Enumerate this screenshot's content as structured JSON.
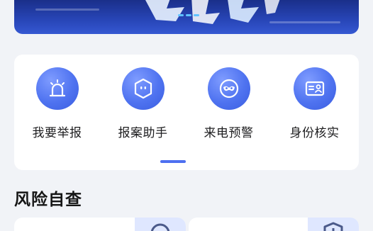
{
  "banner": {
    "image_icon": "banner-image"
  },
  "services": [
    {
      "label": "我要举报",
      "icon": "alarm-light-icon"
    },
    {
      "label": "报案助手",
      "icon": "robot-assistant-icon"
    },
    {
      "label": "来电预警",
      "icon": "mask-warning-icon"
    },
    {
      "label": "身份核实",
      "icon": "id-card-icon"
    }
  ],
  "section": {
    "title": "风险自查"
  },
  "colors": {
    "accent": "#4d6ff0",
    "icon_gradient_light": "#7f9cff",
    "icon_gradient_dark": "#3a5de0",
    "banner_dark": "#1a2f8a",
    "page_bg": "#f1f3f7"
  }
}
